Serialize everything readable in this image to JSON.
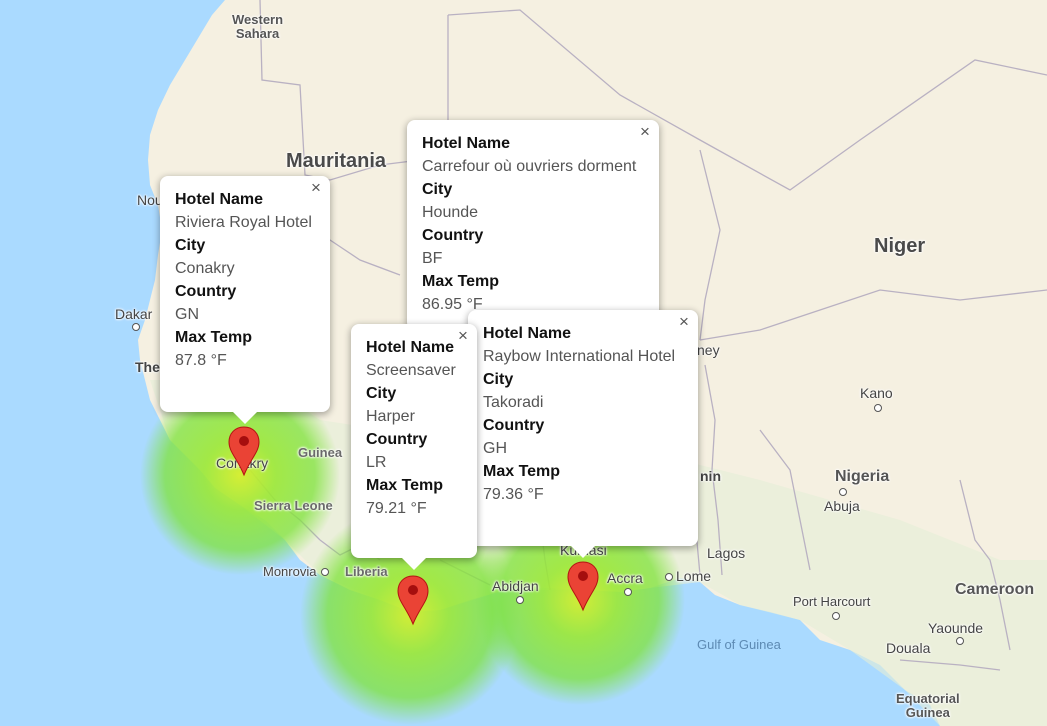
{
  "map_labels": {
    "western_sahara": "Western\nSahara",
    "mauritania": "Mauritania",
    "niger": "Niger",
    "nigeria": "Nigeria",
    "cameroon": "Cameroon",
    "equatorial_guinea": "Equatorial\nGuinea",
    "guinea": "Guinea",
    "sierra_leone": "Sierra Leone",
    "liberia": "Liberia",
    "dakar": "Dakar",
    "nou": "Nou",
    "the": "The",
    "conakry": "Conakry",
    "monrovia": "Monrovia",
    "abidjan": "Abidjan",
    "kumasi": "Kumasi",
    "accra": "Accra",
    "lome": "Lome",
    "lagos": "Lagos",
    "kano": "Kano",
    "abuja": "Abuja",
    "port_harcourt": "Port Harcourt",
    "yaounde": "Yaounde",
    "douala": "Douala",
    "gulf_of_guinea": "Gulf of Guinea",
    "niamey_fragment": "ney",
    "benin_fragment": "nin"
  },
  "info_windows": [
    {
      "id": "conakry",
      "rows": [
        {
          "key": "Hotel Name",
          "value": "Riviera Royal Hotel"
        },
        {
          "key": "City",
          "value": "Conakry"
        },
        {
          "key": "Country",
          "value": "GN"
        },
        {
          "key": "Max Temp",
          "value": "87.8 °F"
        }
      ]
    },
    {
      "id": "hounde",
      "rows": [
        {
          "key": "Hotel Name",
          "value": "Carrefour où ouvriers dorment"
        },
        {
          "key": "City",
          "value": "Hounde"
        },
        {
          "key": "Country",
          "value": "BF"
        },
        {
          "key": "Max Temp",
          "value": "86.95 °F"
        }
      ]
    },
    {
      "id": "harper",
      "rows": [
        {
          "key": "Hotel Name",
          "value": "Screensaver"
        },
        {
          "key": "City",
          "value": "Harper"
        },
        {
          "key": "Country",
          "value": "LR"
        },
        {
          "key": "Max Temp",
          "value": "79.21 °F"
        }
      ]
    },
    {
      "id": "takoradi",
      "rows": [
        {
          "key": "Hotel Name",
          "value": "Raybow International Hotel"
        },
        {
          "key": "City",
          "value": "Takoradi"
        },
        {
          "key": "Country",
          "value": "GH"
        },
        {
          "key": "Max Temp",
          "value": "79.36 °F"
        }
      ]
    }
  ],
  "close_symbol": "×",
  "colors": {
    "ocean": "#aadaff",
    "land": "#f5f0e1",
    "pin": "#ea4335",
    "heatmap": "#7fe33a"
  }
}
